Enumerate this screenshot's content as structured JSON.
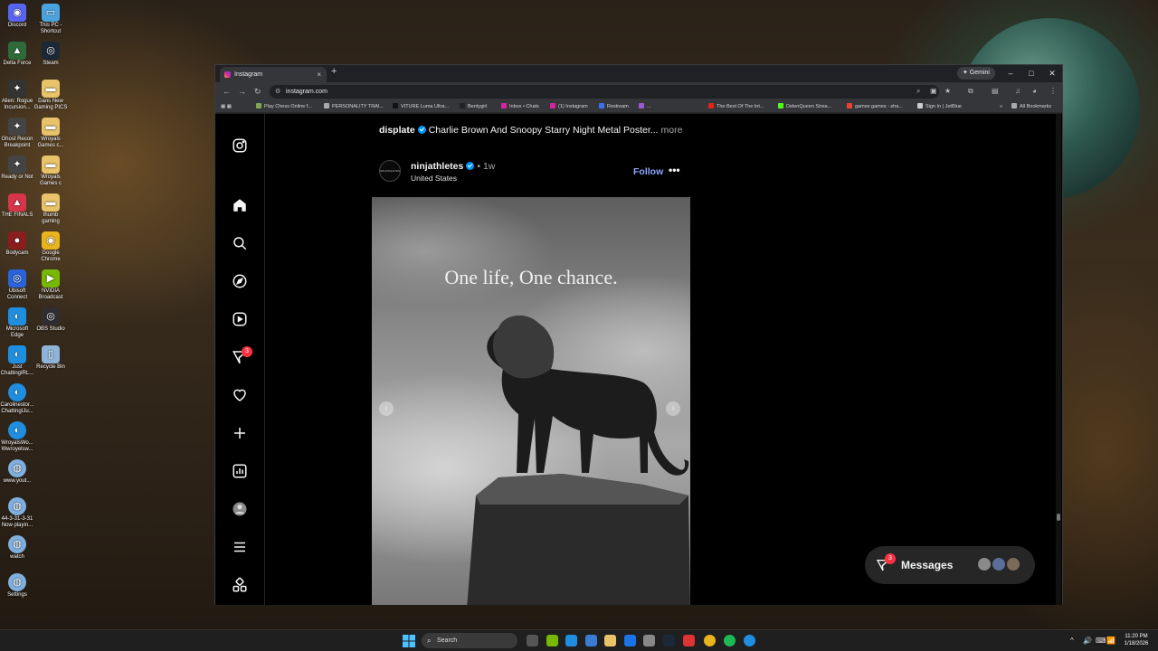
{
  "desktop": {
    "icons": [
      {
        "label": "Discord",
        "color": "#5865f2",
        "glyph": "◉"
      },
      {
        "label": "This PC - Shortcut",
        "color": "#4aa3df",
        "glyph": "▭"
      },
      {
        "label": "Delta Force",
        "color": "#2f6b3a",
        "glyph": "▲"
      },
      {
        "label": "Steam",
        "color": "#1b2838",
        "glyph": "◎"
      },
      {
        "label": "Alien: Rogue Incursion...",
        "color": "#333",
        "glyph": "✦"
      },
      {
        "label": "Dans New Gaming PICS",
        "color": "#e8c36a",
        "glyph": "▬"
      },
      {
        "label": "Ghost Recon Breakpoint",
        "color": "#444",
        "glyph": "✦"
      },
      {
        "label": "Wroyals Games c...",
        "color": "#e8c36a",
        "glyph": "▬"
      },
      {
        "label": "Ready or Not",
        "color": "#444",
        "glyph": "✦"
      },
      {
        "label": "Wroyals Games c",
        "color": "#e8c36a",
        "glyph": "▬"
      },
      {
        "label": "THE FINALS",
        "color": "#d8344a",
        "glyph": "▲"
      },
      {
        "label": "thumb gaming",
        "color": "#e8c36a",
        "glyph": "▬"
      },
      {
        "label": "Bodycam",
        "color": "#8a1e1e",
        "glyph": "●"
      },
      {
        "label": "Google Chrome",
        "color": "#e9b41e",
        "glyph": "◉"
      },
      {
        "label": "Ubisoft Connect",
        "color": "#2b63d9",
        "glyph": "◎"
      },
      {
        "label": "NVIDIA Broadcast",
        "color": "#76b900",
        "glyph": "▶"
      },
      {
        "label": "Microsoft Edge",
        "color": "#1f8ee0",
        "glyph": "◐"
      },
      {
        "label": "OBS Studio",
        "color": "#302e31",
        "glyph": "◎"
      },
      {
        "label": "Just ChattingIRL...",
        "color": "#1f8ee0",
        "glyph": "◐"
      },
      {
        "label": "Recycle Bin",
        "color": "#8fb4d9",
        "glyph": "▯"
      },
      {
        "label": "Carolinestor... ChattingIJu...",
        "color": "#1f8ee0",
        "glyph": "◐"
      },
      {
        "label": "WroyalsWo... Wwroyelsw...",
        "color": "#1f8ee0",
        "glyph": "◐"
      },
      {
        "label": "www.yout...",
        "color": "#7fb0e0",
        "glyph": "◍"
      },
      {
        "label": "44-3-31-3-31 Now playin...",
        "color": "#7fb0e0",
        "glyph": "◍"
      },
      {
        "label": "watch",
        "color": "#7fb0e0",
        "glyph": "◍"
      },
      {
        "label": "Settings",
        "color": "#7fb0e0",
        "glyph": "◍"
      }
    ]
  },
  "browser": {
    "tab_title": "Instagram",
    "tab_close": "×",
    "new_tab": "+",
    "gemini_label": "✦ Gemini",
    "controls": {
      "minimize": "–",
      "maximize": "□",
      "close": "✕"
    },
    "nav": {
      "back": "←",
      "forward": "→",
      "reload": "↻"
    },
    "url": "instagram.com",
    "bookmarks": [
      {
        "label": "Play Chess Online f...",
        "color": "#7fa650"
      },
      {
        "label": "PERSONALITY TRAI...",
        "color": "#aaaaaa"
      },
      {
        "label": "VITURE Luma Ultra...",
        "color": "#111111"
      },
      {
        "label": "Bentygirl",
        "color": "#222222"
      },
      {
        "label": "Inbox • Chats",
        "color": "#d6249f"
      },
      {
        "label": "(1) Instagram",
        "color": "#d6249f"
      },
      {
        "label": "Restream",
        "color": "#3b6ff5"
      },
      {
        "label": "...",
        "color": "#9b59d0"
      },
      {
        "label": "The Best Of The Int...",
        "color": "#e62117"
      },
      {
        "label": "DelenQueen Strea...",
        "color": "#53fc18"
      },
      {
        "label": "games games - sha...",
        "color": "#ea4335"
      },
      {
        "label": "Sign In | JetBlue",
        "color": "#cccccc"
      },
      {
        "label": "»",
        "color": "#35363a"
      },
      {
        "label": "All Bookmarks",
        "color": "#aaaaaa"
      }
    ]
  },
  "instagram": {
    "sidebar_icons": [
      "instagram-logo-icon",
      "home-icon",
      "search-icon",
      "explore-icon",
      "reels-icon",
      "messages-icon",
      "notifications-icon",
      "create-icon",
      "dashboard-icon",
      "profile-icon",
      "more-menu-icon",
      "also-from-meta-icon"
    ],
    "messages_badge": "3",
    "caption": {
      "username": "displate",
      "text": "Charlie Brown And Snoopy Starry Night Metal Poster...",
      "more": "more"
    },
    "post": {
      "username": "ninjathletes",
      "time": "• 1w",
      "location": "United States",
      "follow_label": "Follow",
      "options_label": "•••",
      "avatar_text": "NINJATHLETES",
      "image_text": "One life, One chance.",
      "prev_label": "‹",
      "next_label": "›"
    },
    "messages_bar": {
      "label": "Messages",
      "badge": "3"
    }
  },
  "taskbar": {
    "search_placeholder": "Search",
    "time": "11:20 PM",
    "date": "1/18/2026",
    "tray": [
      "^",
      "🔊",
      "⌨",
      "📶",
      "🔋"
    ]
  }
}
